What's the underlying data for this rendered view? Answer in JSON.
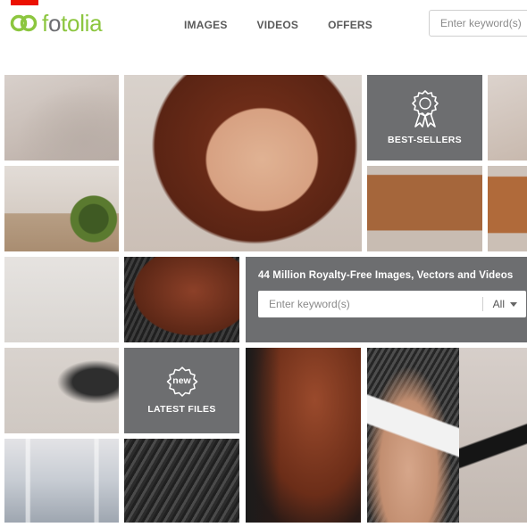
{
  "header": {
    "logo_text_prefix": "f",
    "logo_text_o": "o",
    "logo_text_rest": "tolia",
    "logo_text_suffix": "",
    "search_placeholder": "Enter keyword(s)"
  },
  "nav": {
    "items": [
      {
        "label": "IMAGES"
      },
      {
        "label": "VIDEOS"
      },
      {
        "label": "OFFERS"
      }
    ]
  },
  "tiles": {
    "best_sellers": {
      "label": "BEST-SELLERS",
      "icon": "award-ribbon-icon"
    },
    "latest_files": {
      "label": "LATEST FILES",
      "badge": "new",
      "icon": "new-badge-icon"
    }
  },
  "search_panel": {
    "heading": "44 Million Royalty-Free Images, Vectors and Videos",
    "placeholder": "Enter keyword(s)",
    "filter_value": "All"
  },
  "colors": {
    "brand_green": "#8cc63f",
    "brand_grey": "#6d6e71",
    "adobe_red": "#eb1000",
    "tile_grey": "#6d6e70"
  }
}
